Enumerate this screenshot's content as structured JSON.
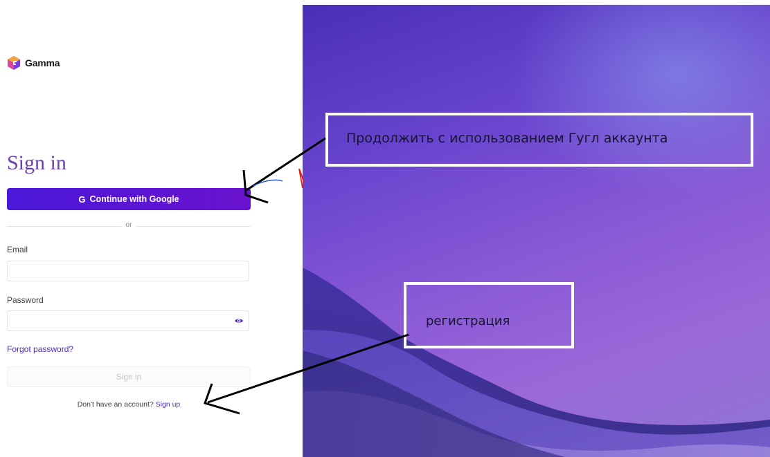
{
  "logo": {
    "text": "Gamma"
  },
  "signin": {
    "title": "Sign in",
    "google_button": "Continue with Google",
    "google_glyph": "G",
    "divider": "or",
    "email_label": "Email",
    "email_value": "",
    "password_label": "Password",
    "password_value": "",
    "forgot": "Forgot password?",
    "signin_button": "Sign in",
    "no_account": "Don't have an account?",
    "signup_link": "Sign up"
  },
  "annotations": {
    "google_note": "Продолжить с использованием Гугл аккаунта",
    "signup_note": "регистрация"
  },
  "colors": {
    "accent": "#5a16d4",
    "link": "#4b2ccf",
    "title": "#6a3fb0"
  }
}
